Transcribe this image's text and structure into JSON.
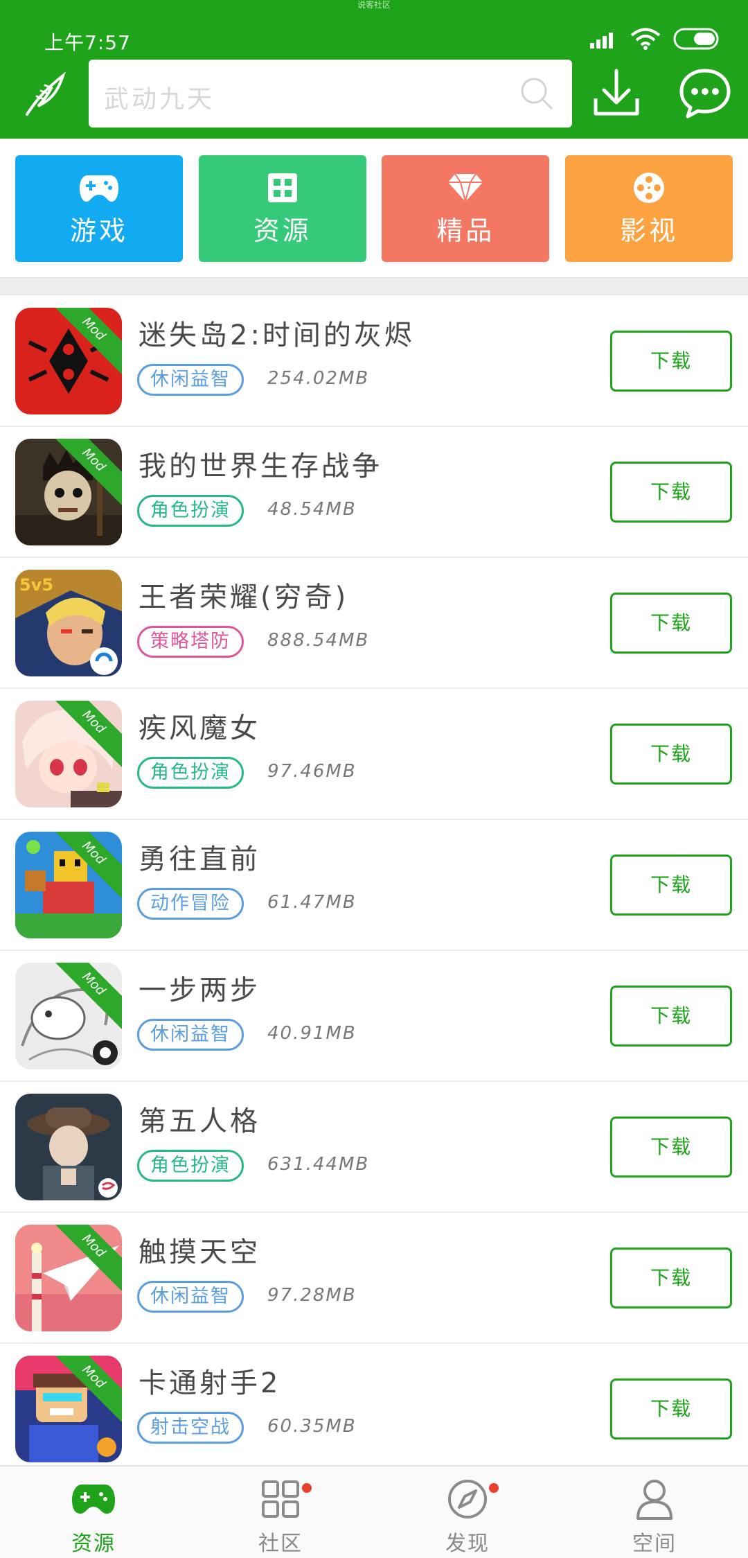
{
  "top_caption": "说客社区",
  "status": {
    "time": "上午7:57"
  },
  "search": {
    "placeholder": "武动九天"
  },
  "colors": {
    "brand": "#1ea31a",
    "tile_game": "#12aaf0",
    "tile_resource": "#35c97a",
    "tile_premium": "#f47764",
    "tile_video": "#fca241",
    "badge_red": "#e8412c"
  },
  "categories": [
    {
      "label": "游戏",
      "icon": "gamepad-icon",
      "color": "#12aaf0"
    },
    {
      "label": "资源",
      "icon": "grid-icon",
      "color": "#35c97a"
    },
    {
      "label": "精品",
      "icon": "diamond-icon",
      "color": "#f47764"
    },
    {
      "label": "影视",
      "icon": "film-reel-icon",
      "color": "#fca241"
    }
  ],
  "apps": [
    {
      "name": "迷失岛2:时间的灰烬",
      "tag": "休闲益智",
      "tag_color": "#5a9de0",
      "size": "254.02MB",
      "mod": true,
      "button": "下载"
    },
    {
      "name": "我的世界生存战争",
      "tag": "角色扮演",
      "tag_color": "#27b88a",
      "size": "48.54MB",
      "mod": true,
      "button": "下载"
    },
    {
      "name": "王者荣耀(穷奇)",
      "tag": "策略塔防",
      "tag_color": "#e0559a",
      "size": "888.54MB",
      "mod": false,
      "button": "下载"
    },
    {
      "name": "疾风魔女",
      "tag": "角色扮演",
      "tag_color": "#27b88a",
      "size": "97.46MB",
      "mod": true,
      "button": "下载"
    },
    {
      "name": "勇往直前",
      "tag": "动作冒险",
      "tag_color": "#5a9de0",
      "size": "61.47MB",
      "mod": true,
      "button": "下载"
    },
    {
      "name": "一步两步",
      "tag": "休闲益智",
      "tag_color": "#5a9de0",
      "size": "40.91MB",
      "mod": true,
      "button": "下载"
    },
    {
      "name": "第五人格",
      "tag": "角色扮演",
      "tag_color": "#27b88a",
      "size": "631.44MB",
      "mod": false,
      "button": "下载"
    },
    {
      "name": "触摸天空",
      "tag": "休闲益智",
      "tag_color": "#5a9de0",
      "size": "97.28MB",
      "mod": true,
      "button": "下载"
    },
    {
      "name": "卡通射手2",
      "tag": "射击空战",
      "tag_color": "#5a9de0",
      "size": "60.35MB",
      "mod": true,
      "button": "下载"
    }
  ],
  "mod_label": "Mod",
  "nav": [
    {
      "label": "资源",
      "icon": "gamepad-icon",
      "active": true,
      "badge": false
    },
    {
      "label": "社区",
      "icon": "grid-icon",
      "active": false,
      "badge": true
    },
    {
      "label": "发现",
      "icon": "compass-icon",
      "active": false,
      "badge": true
    },
    {
      "label": "空间",
      "icon": "person-icon",
      "active": false,
      "badge": false
    }
  ]
}
